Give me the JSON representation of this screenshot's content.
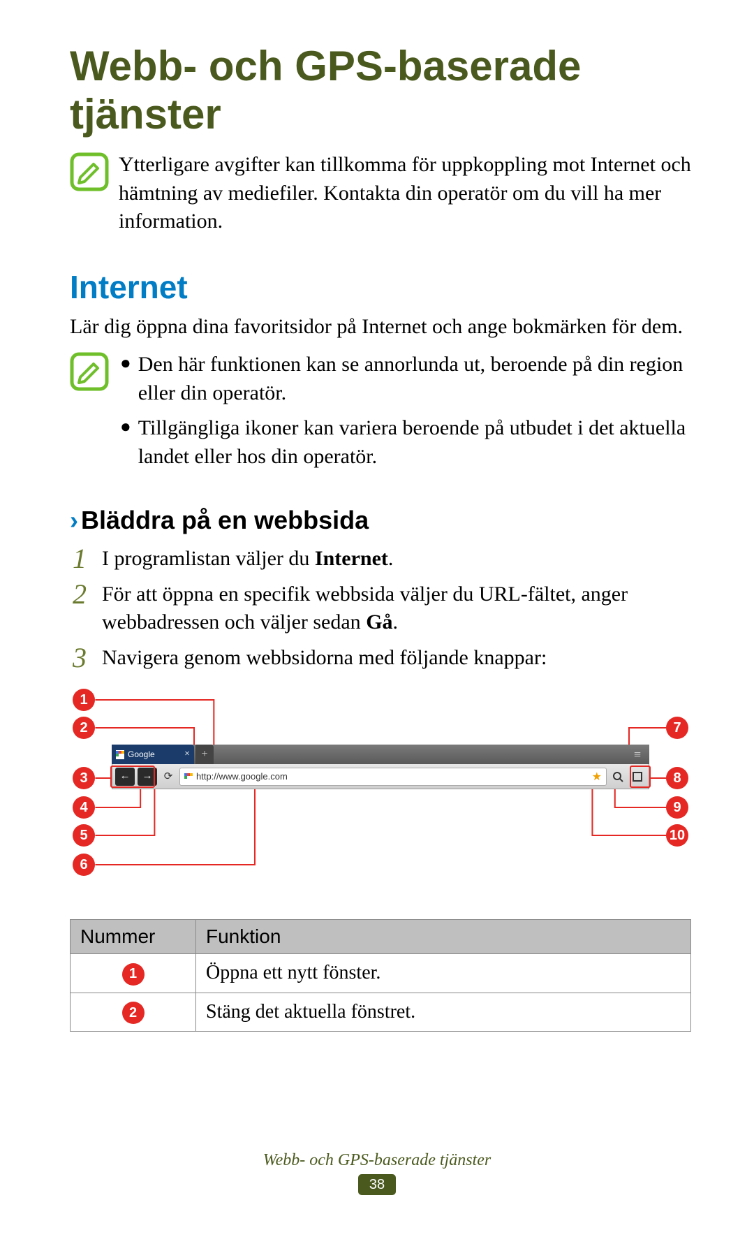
{
  "title": "Webb- och GPS-baserade tjänster",
  "note1": "Ytterligare avgifter kan tillkomma för uppkoppling mot Internet och hämtning av mediefiler. Kontakta din operatör om du vill ha mer information.",
  "section": "Internet",
  "intro": "Lär dig öppna dina favoritsidor på Internet och ange bokmärken för dem.",
  "bullets": [
    "Den här funktionen kan se annorlunda ut, beroende på din region eller din operatör.",
    "Tillgängliga ikoner kan variera beroende på utbudet i det aktuella landet eller hos din operatör."
  ],
  "subheading": "Bläddra på en webbsida",
  "steps": [
    {
      "num": "1",
      "html": "I programlistan väljer du <b>Internet</b>."
    },
    {
      "num": "2",
      "html": "För att öppna en specifik webbsida väljer du URL-fältet, anger webbadressen och väljer sedan <b>Gå</b>."
    },
    {
      "num": "3",
      "html": "Navigera genom webbsidorna med följande knappar:"
    }
  ],
  "browser": {
    "tab_label": "Google",
    "url": "http://www.google.com"
  },
  "table": {
    "head_num": "Nummer",
    "head_func": "Funktion",
    "rows": [
      {
        "n": "1",
        "f": "Öppna ett nytt fönster."
      },
      {
        "n": "2",
        "f": "Stäng det aktuella fönstret."
      }
    ]
  },
  "footer_title": "Webb- och GPS-baserade tjänster",
  "page_number": "38"
}
